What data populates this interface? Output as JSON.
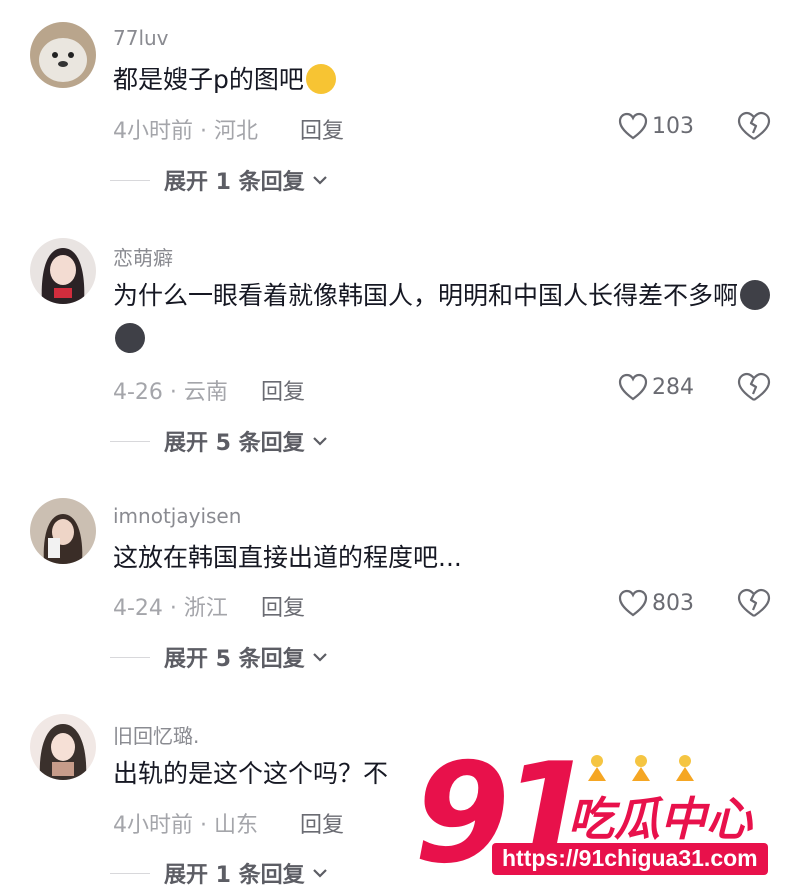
{
  "comments": [
    {
      "username": "77luv",
      "text": "都是嫂子p的图吧",
      "emojis": [
        "laugh-cry-emoji"
      ],
      "time": "4小时前 · 河北",
      "reply_label": "回复",
      "likes": "103",
      "expand_label": "展开 1 条回复"
    },
    {
      "username": "恋萌癖",
      "text": "为什么一眼看着就像韩国人，明明和中国人长得差不多啊",
      "emojis": [
        "dark-face-emoji",
        "dark-face-emoji"
      ],
      "time": "4-26 · 云南",
      "reply_label": "回复",
      "likes": "284",
      "expand_label": "展开 5 条回复"
    },
    {
      "username": "imnotjayisen",
      "text": "这放在韩国直接出道的程度吧...",
      "emojis": [],
      "time": "4-24 · 浙江",
      "reply_label": "回复",
      "likes": "803",
      "expand_label": "展开 5 条回复"
    },
    {
      "username": "旧回忆璐.",
      "text": "出轨的是这个这个吗？不",
      "emojis": [],
      "time": "4小时前 · 山东",
      "reply_label": "回复",
      "likes": "",
      "expand_label": "展开 1 条回复"
    }
  ],
  "watermark": {
    "number": "91",
    "title": "吃瓜中心",
    "url": "https://91chigua31.com"
  },
  "colors": {
    "text": "#161823",
    "muted": "#a4a5aa",
    "watermark": "#e8114b"
  }
}
